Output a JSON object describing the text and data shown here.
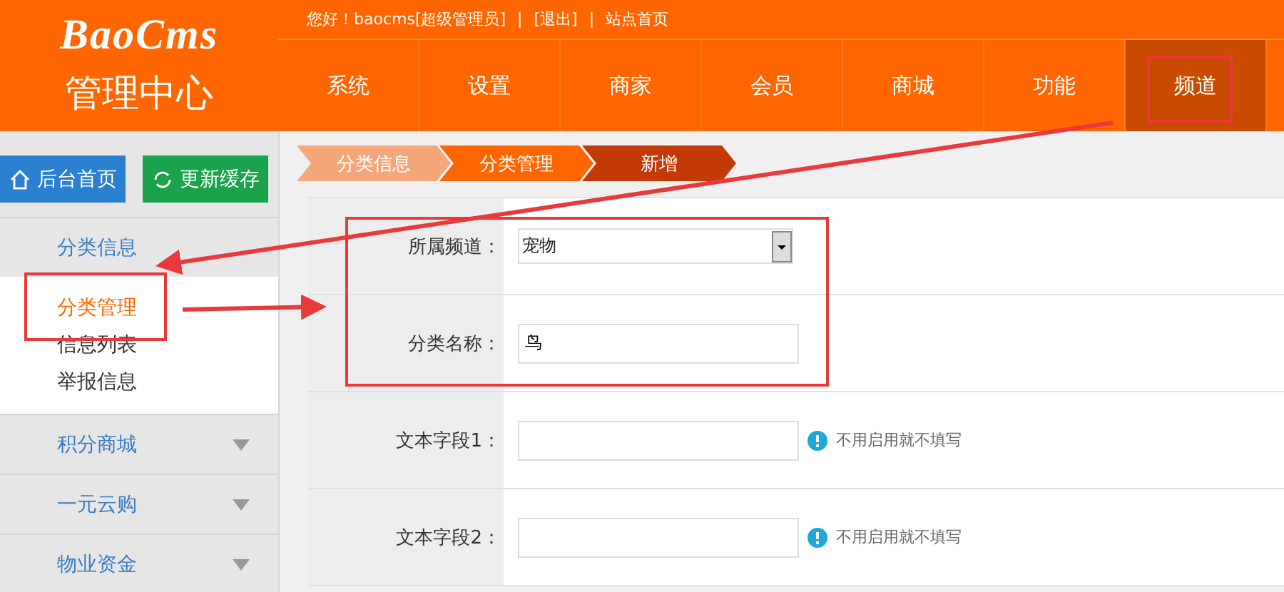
{
  "logo": {
    "brand": "BaoCms",
    "subtitle": "管理中心"
  },
  "top_bar": {
    "greeting": "您好！baocms[超级管理员]",
    "links": [
      "[退出]",
      "站点首页"
    ],
    "separator": "|"
  },
  "nav": [
    {
      "label": "系统",
      "selected": false
    },
    {
      "label": "设置",
      "selected": false
    },
    {
      "label": "商家",
      "selected": false
    },
    {
      "label": "会员",
      "selected": false
    },
    {
      "label": "商城",
      "selected": false
    },
    {
      "label": "功能",
      "selected": false
    },
    {
      "label": "频道",
      "selected": true
    }
  ],
  "quick_buttons": [
    {
      "kind": "home",
      "label": "后台首页"
    },
    {
      "kind": "refresh",
      "label": "更新缓存"
    }
  ],
  "sidebar": [
    {
      "label": "分类信息",
      "expanded": true,
      "children": [
        {
          "label": "分类管理",
          "selected": true
        },
        {
          "label": "信息列表",
          "selected": false
        },
        {
          "label": "举报信息",
          "selected": false
        }
      ]
    },
    {
      "label": "积分商城",
      "expanded": false
    },
    {
      "label": "一元云购",
      "expanded": false
    },
    {
      "label": "物业资金",
      "expanded": false
    }
  ],
  "breadcrumb": [
    {
      "label": "分类信息",
      "selected": false
    },
    {
      "label": "分类管理",
      "selected": false
    },
    {
      "label": "新增",
      "selected": true
    }
  ],
  "form": [
    {
      "kind": "select",
      "label": "所属频道：",
      "value": "宠物"
    },
    {
      "kind": "input",
      "label": "分类名称：",
      "value": "鸟"
    },
    {
      "kind": "input",
      "label": "文本字段1：",
      "hint": "不用启用就不填写"
    },
    {
      "kind": "input",
      "label": "文本字段2：",
      "hint": "不用启用就不填写"
    }
  ]
}
